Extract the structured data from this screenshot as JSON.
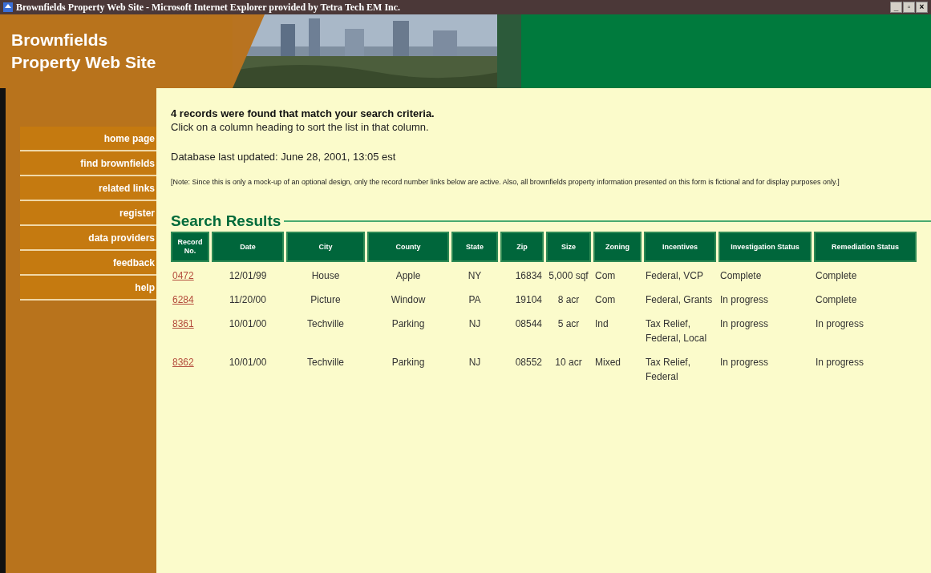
{
  "window": {
    "title": "Brownfields Property Web Site - Microsoft Internet Explorer provided by Tetra Tech EM Inc.",
    "controls": [
      "_",
      "▫",
      "×"
    ]
  },
  "header": {
    "title_lines": [
      "Brownfields",
      "Property Web Site"
    ],
    "banner": {
      "kind": "picture"
    }
  },
  "sidebar": {
    "items": [
      {
        "label": "home page"
      },
      {
        "label": "find brownfields"
      },
      {
        "label": "related links"
      },
      {
        "label": "register"
      },
      {
        "label": "data providers"
      },
      {
        "label": "feedback"
      },
      {
        "label": "help"
      }
    ]
  },
  "summary": "4 records were found that match your search criteria.",
  "sort_hint": "Click on a column heading to sort the list in that column.",
  "updated": "Database last updated: June 28, 2001, 13:05 est",
  "note": "[Note: Since this is only a mock-up of an optional design, only the record number links below are active. Also, all brownfields property information presented on this form is fictional and for display purposes only.]",
  "results": {
    "title": "Search Results",
    "columns": [
      "Record No.",
      "Date",
      "City",
      "County",
      "State",
      "Zip",
      "Size",
      "Zoning",
      "Incentives",
      "Investigation Status",
      "Remediation Status"
    ],
    "rows": [
      [
        "0472",
        "12/01/99",
        "House",
        "Apple",
        "NY",
        "16834",
        "5,000 sqf",
        "Com",
        "Federal, VCP",
        "Complete",
        "Complete"
      ],
      [
        "6284",
        "11/20/00",
        "Picture",
        "Window",
        "PA",
        "19104",
        "8 acr",
        "Com",
        "Federal, Grants",
        "In progress",
        "Complete"
      ],
      [
        "8361",
        "10/01/00",
        "Techville",
        "Parking",
        "NJ",
        "08544",
        "5 acr",
        "Ind",
        "Tax Relief, Federal, Local",
        "In progress",
        "In progress"
      ],
      [
        "8362",
        "10/01/00",
        "Techville",
        "Parking",
        "NJ",
        "08552",
        "10 acr",
        "Mixed",
        "Tax Relief, Federal",
        "In progress",
        "In progress"
      ]
    ]
  }
}
